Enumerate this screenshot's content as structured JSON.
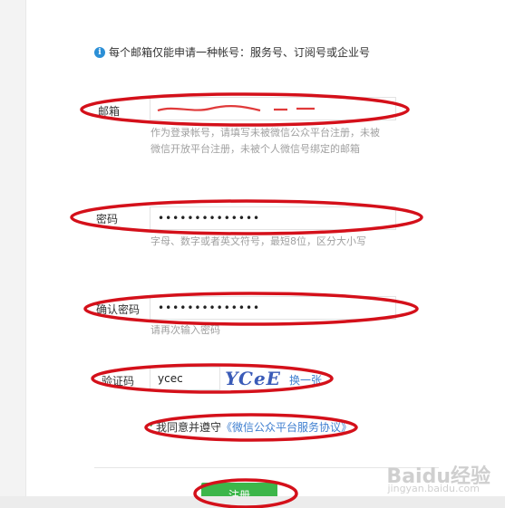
{
  "notice": {
    "text": "每个邮箱仅能申请一种帐号：服务号、订阅号或企业号",
    "icon": "info-icon"
  },
  "form": {
    "email": {
      "label": "邮箱",
      "hint": "作为登录帐号，请填写未被微信公众平台注册，未被微信开放平台注册，未被个人微信号绑定的邮箱"
    },
    "password": {
      "label": "密码",
      "value": "••••••••••••••",
      "hint": "字母、数字或者英文符号，最短8位，区分大小写"
    },
    "confirm_password": {
      "label": "确认密码",
      "value": "••••••••••••••",
      "hint": "请再次输入密码"
    },
    "captcha": {
      "label": "验证码",
      "value": "ycec",
      "image_text": "YCeE",
      "refresh_link": "换一张"
    },
    "agreement": {
      "text": "我同意并遵守",
      "link": "《微信公众平台服务协议》"
    },
    "submit_label": "注册"
  },
  "watermark": {
    "main": "Baidu经验",
    "sub": "jingyan.baidu.com"
  },
  "colors": {
    "annotation_red": "#d4101a",
    "submit_green": "#3cb64a",
    "link_blue": "#3f7fd0",
    "info_blue": "#2b8fd6"
  }
}
